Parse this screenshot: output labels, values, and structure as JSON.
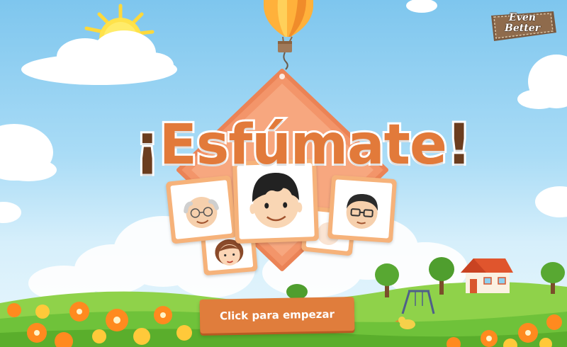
{
  "game": {
    "title": "Esfúmate",
    "title_open_mark": "¡",
    "title_close_mark": "!",
    "start_button_label": "Click para empezar",
    "brand_line1": "Even",
    "brand_line2": "Better"
  },
  "colors": {
    "title_orange": "#e27a3a",
    "title_mark_brown": "#6b3d1f",
    "button_orange": "#e07d3c",
    "card_orange": "#f6b27a",
    "sky_top": "#7ec6ee",
    "grass_green": "#6fc23a",
    "diamond_orange": "#f3956a"
  },
  "icons": {
    "sun": "sun-icon",
    "balloon": "hot-air-balloon-icon",
    "house": "house-icon",
    "swing": "swing-set-icon",
    "duck": "duck-icon",
    "trees": "tree-icon",
    "flowers": "flower-icon"
  }
}
